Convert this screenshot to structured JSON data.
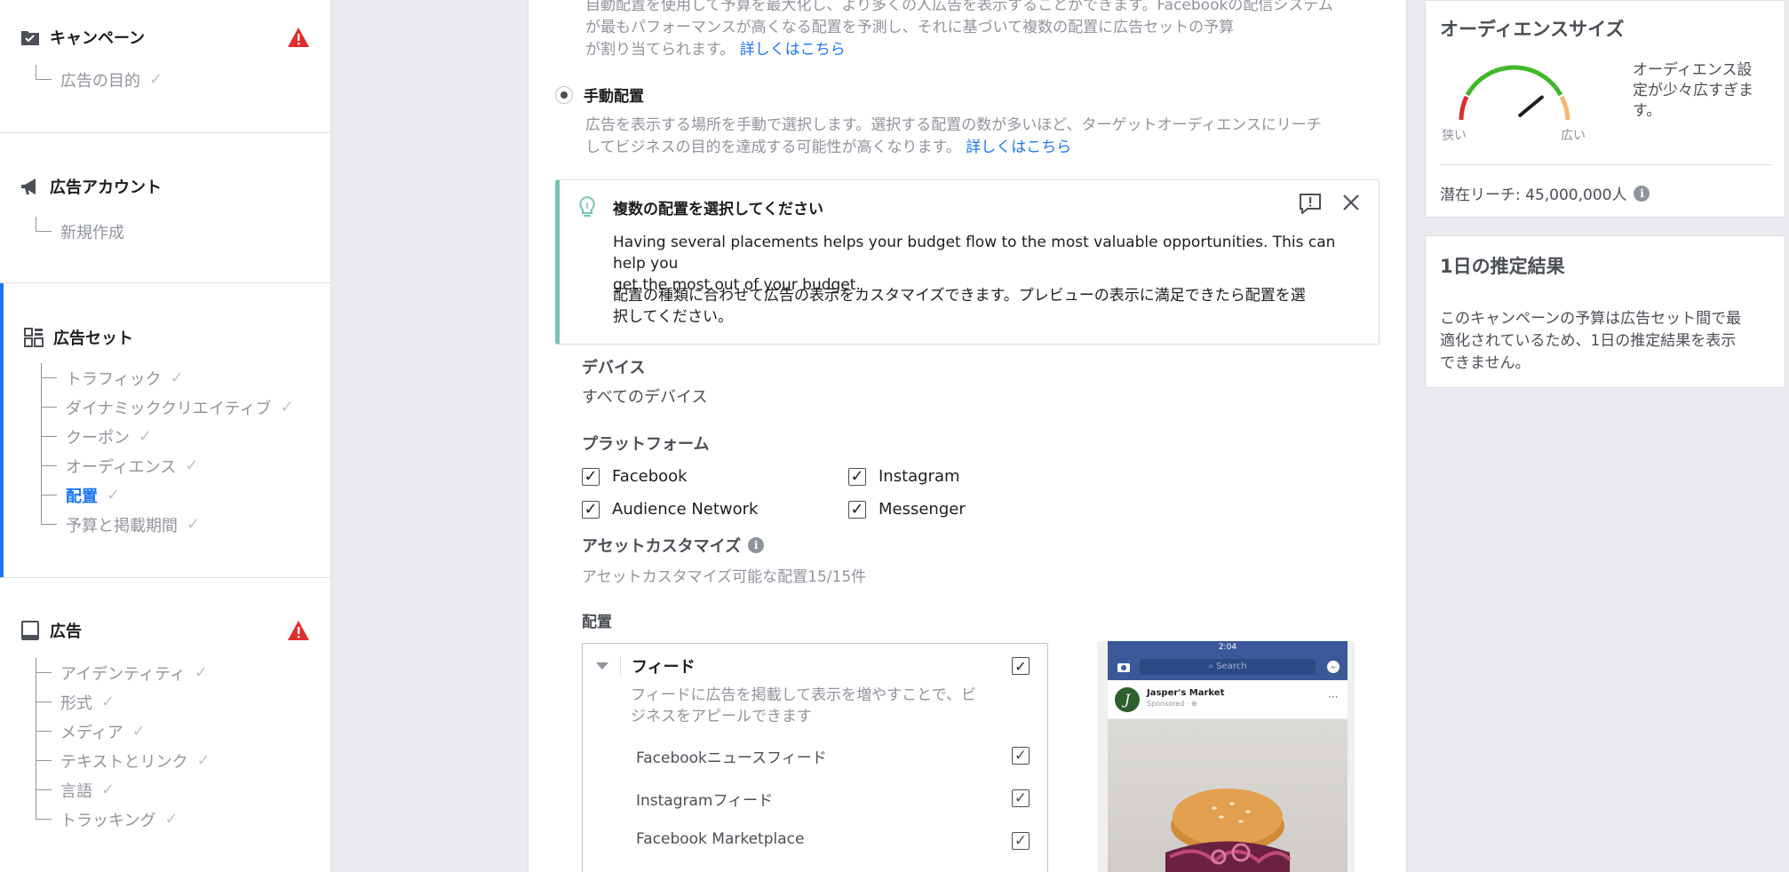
{
  "left_nav": {
    "campaign": {
      "title": "キャンペーン",
      "items": [
        {
          "label": "広告の目的",
          "checked": true
        }
      ]
    },
    "ad_account": {
      "title": "広告アカウント",
      "items": [
        {
          "label": "新規作成"
        }
      ]
    },
    "ad_set": {
      "title": "広告セット",
      "items": [
        {
          "label": "トラフィック",
          "checked": true
        },
        {
          "label": "ダイナミッククリエイティブ",
          "checked": true
        },
        {
          "label": "クーポン",
          "checked": true
        },
        {
          "label": "オーディエンス",
          "checked": true
        },
        {
          "label": "配置",
          "checked": true,
          "current": true
        },
        {
          "label": "予算と掲載期間",
          "checked": true
        }
      ]
    },
    "ad": {
      "title": "広告",
      "items": [
        {
          "label": "アイデンティティ",
          "checked": true
        },
        {
          "label": "形式",
          "checked": true
        },
        {
          "label": "メディア",
          "checked": true
        },
        {
          "label": "テキストとリンク",
          "checked": true
        },
        {
          "label": "言語",
          "checked": true
        },
        {
          "label": "トラッキング",
          "checked": true
        }
      ]
    }
  },
  "center": {
    "auto_text_l1": "自動配置を使用して予算を最大化し、より多くの人広告を表示することができます。Facebookの配信システム",
    "auto_text_l2": "が最もパフォーマンスが高くなる配置を予測し、それに基づいて複数の配置に広告セットの予算",
    "auto_text_l3": "が割り当てられます。",
    "learn_more": "詳しくはこちら",
    "manual_label": "手動配置",
    "manual_text_l1": "広告を表示する場所を手動で選択します。選択する配置の数が多いほど、ターゲットオーディエンスにリーチ",
    "manual_text_l2": "してビジネスの目的を達成する可能性が高くなります。",
    "tip": {
      "title": "複数の配置を選択してください",
      "body1_l1": "Having several placements helps your budget flow to the most valuable opportunities. This can help you",
      "body1_l2": "get the most out of your budget.",
      "body2_l1": "配置の種類に合わせて広告の表示をカスタマイズできます。プレビューの表示に満足できたら配置を選",
      "body2_l2": "択してください。"
    },
    "devices_label": "デバイス",
    "devices_value": "すべてのデバイス",
    "platforms_label": "プラットフォーム",
    "platforms": [
      {
        "label": "Facebook",
        "checked": true
      },
      {
        "label": "Instagram",
        "checked": true
      },
      {
        "label": "Audience Network",
        "checked": true
      },
      {
        "label": "Messenger",
        "checked": true
      }
    ],
    "asset_label": "アセットカスタマイズ",
    "asset_value": "アセットカスタマイズ可能な配置15/15件",
    "placements_label": "配置",
    "feed": {
      "title": "フィード",
      "desc_l1": "フィードに広告を掲載して表示を増やすことで、ビ",
      "desc_l2": "ジネスをアピールできます",
      "items": [
        {
          "label": "Facebookニュースフィード",
          "checked": true
        },
        {
          "label": "Instagramフィード",
          "checked": true
        },
        {
          "label": "Facebook Marketplace",
          "checked": true
        }
      ]
    },
    "preview": {
      "time": "2:04",
      "search": "Search",
      "advertiser": "Jasper's Market",
      "sponsored": "Sponsored · ⊕"
    }
  },
  "right": {
    "audience": {
      "title": "オーディエンスサイズ",
      "message_l1": "オーディエンス設",
      "message_l2": "定が少々広すぎま",
      "message_l3": "す。",
      "narrow": "狭い",
      "broad": "広い",
      "reach": "潜在リーチ: 45,000,000人",
      "gauge_level": 0.78
    },
    "daily": {
      "title": "1日の推定結果",
      "text_l1": "このキャンペーンの予算は広告セット間で最",
      "text_l2": "適化されているため、1日の推定結果を表示",
      "text_l3": "できません。"
    }
  },
  "colors": {
    "accent": "#1877f2",
    "warning": "#e02c2c",
    "tip_border": "#72c7b4",
    "gauge_green": "#42b72a"
  }
}
